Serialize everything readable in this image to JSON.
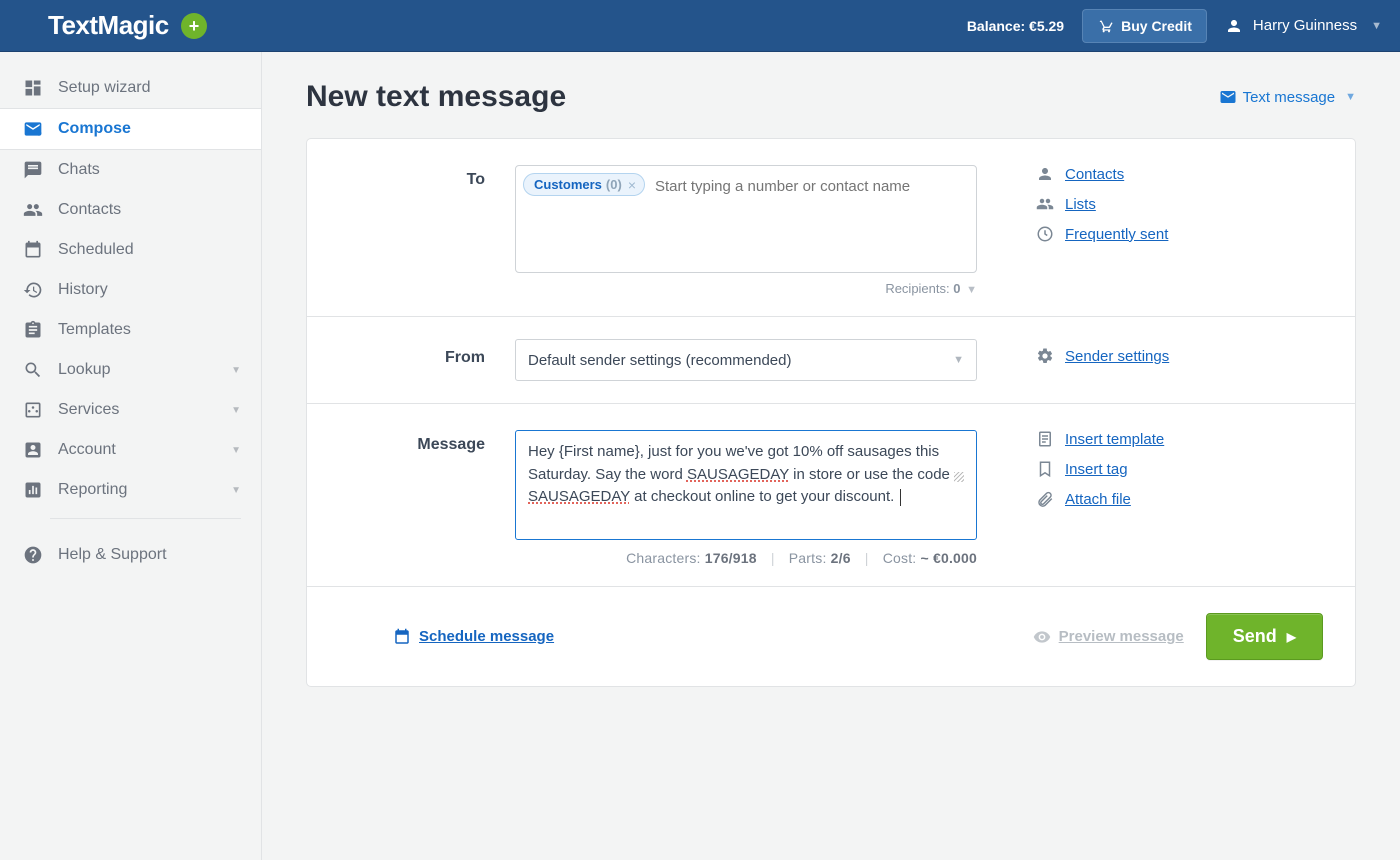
{
  "header": {
    "logo_text": "TextMagic",
    "balance_label": "Balance: €5.29",
    "buy_credit_label": "Buy Credit",
    "user_name": "Harry Guinness"
  },
  "sidebar": {
    "items": [
      {
        "label": "Setup wizard",
        "has_drop": false
      },
      {
        "label": "Compose",
        "has_drop": false
      },
      {
        "label": "Chats",
        "has_drop": false
      },
      {
        "label": "Contacts",
        "has_drop": false
      },
      {
        "label": "Scheduled",
        "has_drop": false
      },
      {
        "label": "History",
        "has_drop": false
      },
      {
        "label": "Templates",
        "has_drop": false
      },
      {
        "label": "Lookup",
        "has_drop": true
      },
      {
        "label": "Services",
        "has_drop": true
      },
      {
        "label": "Account",
        "has_drop": true
      },
      {
        "label": "Reporting",
        "has_drop": true
      }
    ],
    "help_label": "Help & Support"
  },
  "page": {
    "title": "New text message",
    "type_selector": "Text message"
  },
  "to": {
    "label": "To",
    "chip_name": "Customers",
    "chip_count": "(0)",
    "placeholder": "Start typing a number or contact name",
    "recipients_label": "Recipients:",
    "recipients_value": "0",
    "links": {
      "contacts": "Contacts",
      "lists": "Lists",
      "frequent": "Frequently sent"
    }
  },
  "from": {
    "label": "From",
    "value": "Default sender settings (recommended)",
    "link": "Sender settings"
  },
  "message": {
    "label": "Message",
    "prefix": "Hey {First name}, just for you we've got 10% off sausages this Saturday. Say the word ",
    "marked1": "SAUSAGEDAY",
    "middle": " in store or use the code ",
    "marked2": "SAUSAGEDAY",
    "suffix": " at checkout online to get your discount. ",
    "meta_chars_label": "Characters:",
    "meta_chars_value": "176/918",
    "meta_parts_label": "Parts:",
    "meta_parts_value": "2/6",
    "meta_cost_label": "Cost:",
    "meta_cost_value": "~ €0.000",
    "links": {
      "template": "Insert template",
      "tag": "Insert tag",
      "attach": "Attach file"
    }
  },
  "footer": {
    "schedule_label": "Schedule message",
    "preview_label": "Preview message",
    "send_label": "Send"
  }
}
